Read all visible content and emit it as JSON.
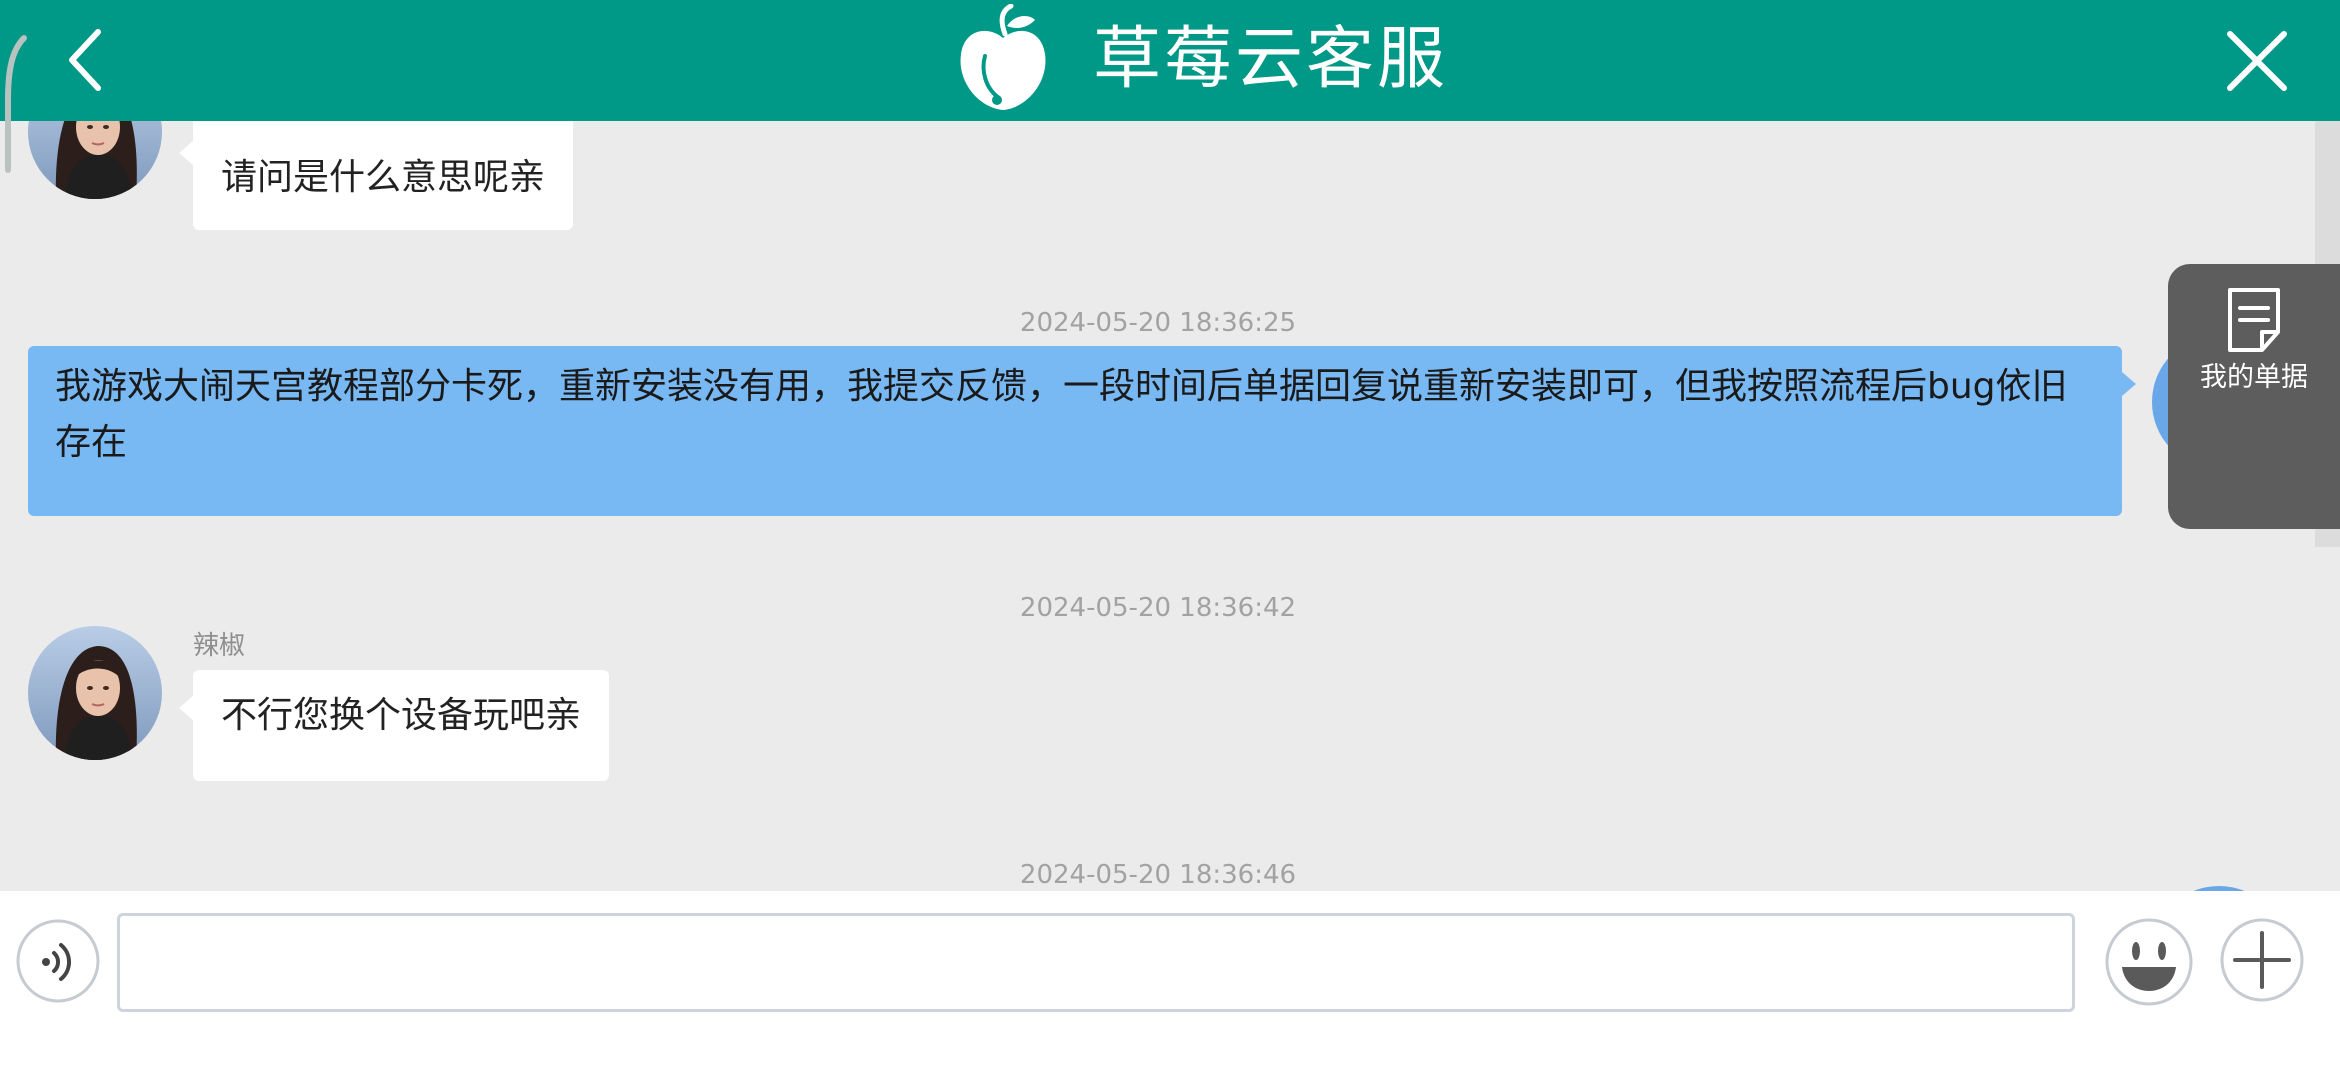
{
  "header": {
    "title": "草莓云客服",
    "back_icon": "chevron-left-icon",
    "close_icon": "close-icon",
    "logo_icon": "strawberry-cloud-logo"
  },
  "colors": {
    "header_bg": "#009886",
    "chat_bg": "#ebebeb",
    "user_bubble": "#78b8f3",
    "agent_bubble": "#ffffff",
    "timestamp_text": "#a2a2a2"
  },
  "messages": [
    {
      "side": "agent",
      "sender": "",
      "text": "请问是什么意思呢亲"
    },
    {
      "side": "user",
      "timestamp": "2024-05-20 18:36:25",
      "text": "我游戏大闹天宫教程部分卡死，重新安装没有用，我提交反馈，一段时间后单据回复说重新安装即可，但我按照流程后bug依旧存在"
    },
    {
      "side": "agent",
      "timestamp": "2024-05-20 18:36:42",
      "sender": "辣椒",
      "text": "不行您换个设备玩吧亲"
    },
    {
      "side": "user",
      "timestamp": "2024-05-20 18:36:46",
      "text": ""
    }
  ],
  "floating_button": {
    "label": "我的单据",
    "icon": "document-icon"
  },
  "input_bar": {
    "voice_icon": "voice-icon",
    "placeholder": "",
    "value": "",
    "emoji_icon": "emoji-icon",
    "plus_icon": "plus-icon"
  }
}
